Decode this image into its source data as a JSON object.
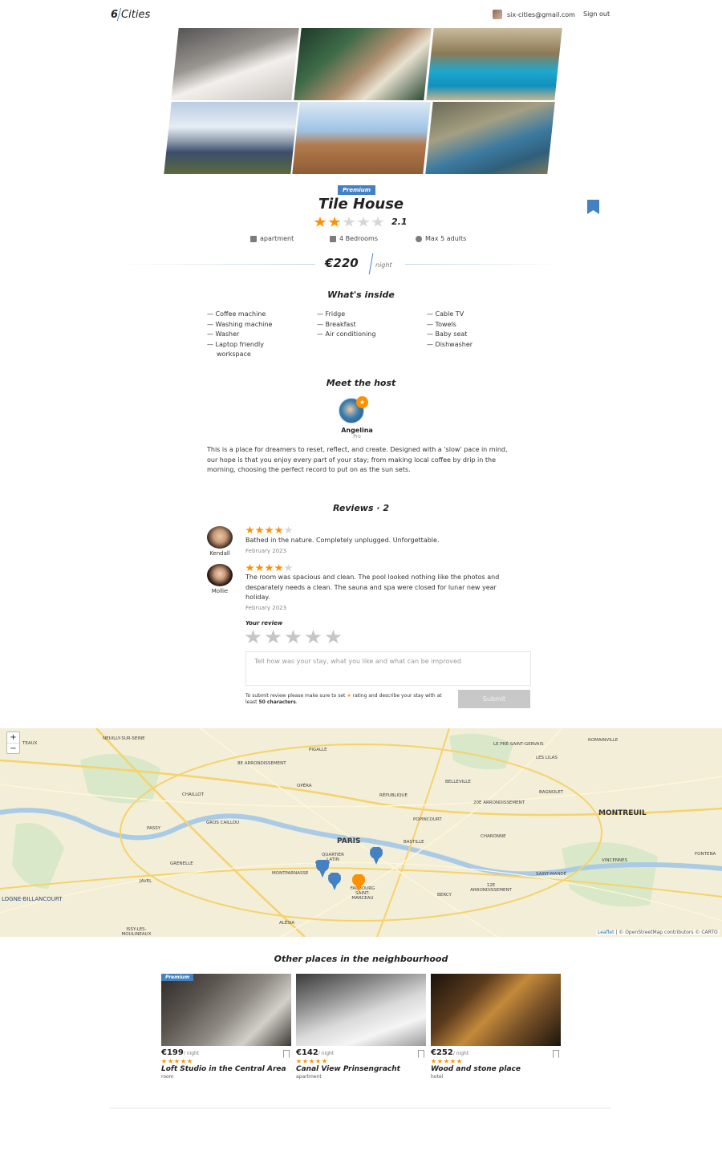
{
  "header": {
    "logo_num": "6",
    "logo_text": "Cities",
    "email": "six-cities@gmail.com",
    "signout": "Sign out"
  },
  "offer": {
    "premium": "Premium",
    "title": "Tile House",
    "rating_value": "2.1",
    "rating_stars": 2,
    "type": "apartment",
    "bedrooms": "4 Bedrooms",
    "adults": "Max 5 adults",
    "price": "€220",
    "price_unit": "night"
  },
  "inside": {
    "title": "What's inside",
    "col1": [
      "Coffee machine",
      "Washing machine",
      "Washer",
      "Laptop friendly",
      "workspace"
    ],
    "col2": [
      "Fridge",
      "Breakfast",
      "Air conditioning"
    ],
    "col3": [
      "Cable TV",
      "Towels",
      "Baby seat",
      "Dishwasher"
    ]
  },
  "host": {
    "title": "Meet the host",
    "name": "Angelina",
    "status": "Pro",
    "description": "This is a place for dreamers to reset, reflect, and create. Designed with a 'slow' pace in mind, our hope is that you enjoy every part of your stay; from making local coffee by drip in the morning, choosing the perfect record to put on as the sun sets."
  },
  "reviews": {
    "title": "Reviews · 2",
    "items": [
      {
        "name": "Kendall",
        "stars": 4,
        "text": "Bathed in the nature. Completely unplugged. Unforgettable.",
        "date": "February 2023"
      },
      {
        "name": "Mollie",
        "stars": 4,
        "text": "The room was spacious and clean. The pool looked nothing like the photos and desparately needs a clean. The sauna and spa were closed for lunar new year holiday.",
        "date": "February 2023"
      }
    ],
    "form_label": "Your review",
    "placeholder": "Tell how was your stay, what you like and what can be improved",
    "help_prefix": "To submit review please make sure to set",
    "help_middle": "rating and describe your stay with at least",
    "help_bold": "50 characters",
    "submit": "Submit"
  },
  "map": {
    "zoom_in": "+",
    "zoom_out": "−",
    "attribution_leaflet": "Leaflet",
    "attribution_rest": "| © OpenStreetMap contributors © CARTO",
    "labels": {
      "neuilly": "Neuilly-sur-Seine",
      "levallois": "teaux",
      "pre": "Le Pré-Saint-Gervais",
      "lilas": "Les Lilas",
      "romainville": "Romainville",
      "pigalle": "Pigalle",
      "arr8": "8e Arrondissement",
      "opera": "Opéra",
      "belleville": "Belleville",
      "bagnolet": "Bagnolet",
      "chaillot": "Chaillot",
      "republique": "République",
      "arr20": "20e Arrondissement",
      "gros": "Gros Caillou",
      "popincourt": "Popincourt",
      "montreuil": "MONTREUIL",
      "passy": "Passy",
      "paris": "PARIS",
      "charonne": "Charonne",
      "bastille": "Bastille",
      "quartier": "Quartier Latin",
      "vincennes": "Vincennes",
      "grenelle": "Grenelle",
      "montparnasse": "Montparnasse",
      "saintmande": "Saint-Mandé",
      "fontenay": "Fontena",
      "javel": "Javel",
      "faubourg": "Faubourg Saint-Marceau",
      "bercy": "Bercy",
      "arr12": "12e Arrondissement",
      "boulogne": "LOGNE-BILLANCOURT",
      "alesia": "Alésia",
      "issy": "Issy-les-Moulineaux"
    }
  },
  "near": {
    "title": "Other places in the neighbourhood",
    "cards": [
      {
        "premium": "Premium",
        "price": "€199",
        "unit": "/ night",
        "name": "Loft Studio in the Central Area",
        "type": "room"
      },
      {
        "premium": "",
        "price": "€142",
        "unit": "/ night",
        "name": "Canal View Prinsengracht",
        "type": "apartment"
      },
      {
        "premium": "",
        "price": "€252",
        "unit": "/ night",
        "name": "Wood and stone place",
        "type": "hotel"
      }
    ]
  },
  "colors": {
    "accent": "#4481c3",
    "star": "#ff9000",
    "active_pin": "#ff9000"
  }
}
